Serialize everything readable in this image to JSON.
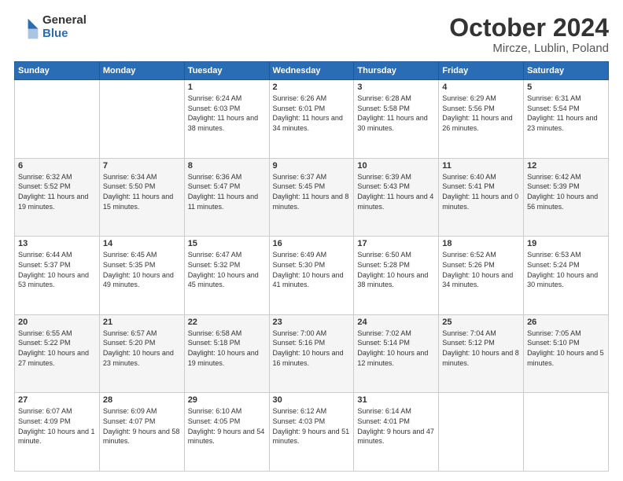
{
  "logo": {
    "general": "General",
    "blue": "Blue"
  },
  "title": "October 2024",
  "subtitle": "Mircze, Lublin, Poland",
  "days_of_week": [
    "Sunday",
    "Monday",
    "Tuesday",
    "Wednesday",
    "Thursday",
    "Friday",
    "Saturday"
  ],
  "weeks": [
    [
      {
        "day": "",
        "info": ""
      },
      {
        "day": "",
        "info": ""
      },
      {
        "day": "1",
        "info": "Sunrise: 6:24 AM\nSunset: 6:03 PM\nDaylight: 11 hours and 38 minutes."
      },
      {
        "day": "2",
        "info": "Sunrise: 6:26 AM\nSunset: 6:01 PM\nDaylight: 11 hours and 34 minutes."
      },
      {
        "day": "3",
        "info": "Sunrise: 6:28 AM\nSunset: 5:58 PM\nDaylight: 11 hours and 30 minutes."
      },
      {
        "day": "4",
        "info": "Sunrise: 6:29 AM\nSunset: 5:56 PM\nDaylight: 11 hours and 26 minutes."
      },
      {
        "day": "5",
        "info": "Sunrise: 6:31 AM\nSunset: 5:54 PM\nDaylight: 11 hours and 23 minutes."
      }
    ],
    [
      {
        "day": "6",
        "info": "Sunrise: 6:32 AM\nSunset: 5:52 PM\nDaylight: 11 hours and 19 minutes."
      },
      {
        "day": "7",
        "info": "Sunrise: 6:34 AM\nSunset: 5:50 PM\nDaylight: 11 hours and 15 minutes."
      },
      {
        "day": "8",
        "info": "Sunrise: 6:36 AM\nSunset: 5:47 PM\nDaylight: 11 hours and 11 minutes."
      },
      {
        "day": "9",
        "info": "Sunrise: 6:37 AM\nSunset: 5:45 PM\nDaylight: 11 hours and 8 minutes."
      },
      {
        "day": "10",
        "info": "Sunrise: 6:39 AM\nSunset: 5:43 PM\nDaylight: 11 hours and 4 minutes."
      },
      {
        "day": "11",
        "info": "Sunrise: 6:40 AM\nSunset: 5:41 PM\nDaylight: 11 hours and 0 minutes."
      },
      {
        "day": "12",
        "info": "Sunrise: 6:42 AM\nSunset: 5:39 PM\nDaylight: 10 hours and 56 minutes."
      }
    ],
    [
      {
        "day": "13",
        "info": "Sunrise: 6:44 AM\nSunset: 5:37 PM\nDaylight: 10 hours and 53 minutes."
      },
      {
        "day": "14",
        "info": "Sunrise: 6:45 AM\nSunset: 5:35 PM\nDaylight: 10 hours and 49 minutes."
      },
      {
        "day": "15",
        "info": "Sunrise: 6:47 AM\nSunset: 5:32 PM\nDaylight: 10 hours and 45 minutes."
      },
      {
        "day": "16",
        "info": "Sunrise: 6:49 AM\nSunset: 5:30 PM\nDaylight: 10 hours and 41 minutes."
      },
      {
        "day": "17",
        "info": "Sunrise: 6:50 AM\nSunset: 5:28 PM\nDaylight: 10 hours and 38 minutes."
      },
      {
        "day": "18",
        "info": "Sunrise: 6:52 AM\nSunset: 5:26 PM\nDaylight: 10 hours and 34 minutes."
      },
      {
        "day": "19",
        "info": "Sunrise: 6:53 AM\nSunset: 5:24 PM\nDaylight: 10 hours and 30 minutes."
      }
    ],
    [
      {
        "day": "20",
        "info": "Sunrise: 6:55 AM\nSunset: 5:22 PM\nDaylight: 10 hours and 27 minutes."
      },
      {
        "day": "21",
        "info": "Sunrise: 6:57 AM\nSunset: 5:20 PM\nDaylight: 10 hours and 23 minutes."
      },
      {
        "day": "22",
        "info": "Sunrise: 6:58 AM\nSunset: 5:18 PM\nDaylight: 10 hours and 19 minutes."
      },
      {
        "day": "23",
        "info": "Sunrise: 7:00 AM\nSunset: 5:16 PM\nDaylight: 10 hours and 16 minutes."
      },
      {
        "day": "24",
        "info": "Sunrise: 7:02 AM\nSunset: 5:14 PM\nDaylight: 10 hours and 12 minutes."
      },
      {
        "day": "25",
        "info": "Sunrise: 7:04 AM\nSunset: 5:12 PM\nDaylight: 10 hours and 8 minutes."
      },
      {
        "day": "26",
        "info": "Sunrise: 7:05 AM\nSunset: 5:10 PM\nDaylight: 10 hours and 5 minutes."
      }
    ],
    [
      {
        "day": "27",
        "info": "Sunrise: 6:07 AM\nSunset: 4:09 PM\nDaylight: 10 hours and 1 minute."
      },
      {
        "day": "28",
        "info": "Sunrise: 6:09 AM\nSunset: 4:07 PM\nDaylight: 9 hours and 58 minutes."
      },
      {
        "day": "29",
        "info": "Sunrise: 6:10 AM\nSunset: 4:05 PM\nDaylight: 9 hours and 54 minutes."
      },
      {
        "day": "30",
        "info": "Sunrise: 6:12 AM\nSunset: 4:03 PM\nDaylight: 9 hours and 51 minutes."
      },
      {
        "day": "31",
        "info": "Sunrise: 6:14 AM\nSunset: 4:01 PM\nDaylight: 9 hours and 47 minutes."
      },
      {
        "day": "",
        "info": ""
      },
      {
        "day": "",
        "info": ""
      }
    ]
  ]
}
